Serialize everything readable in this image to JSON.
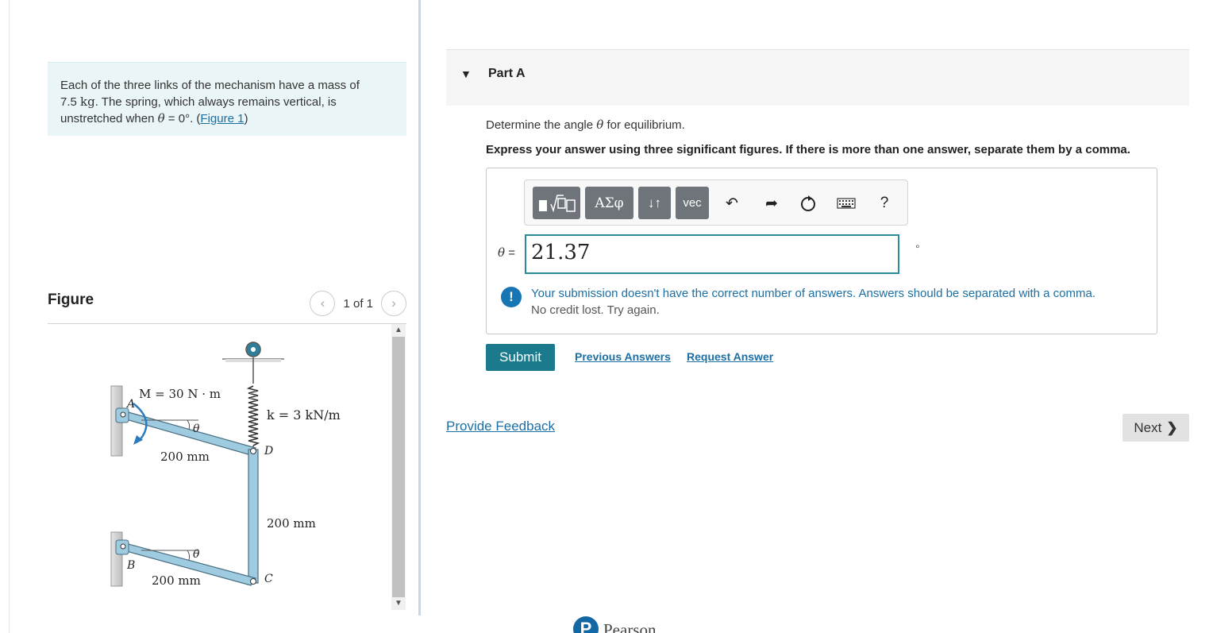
{
  "problem": {
    "text_1": "Each of the three links of the mechanism have a mass of",
    "mass_value": "7.5",
    "mass_unit": "kg",
    "text_2": ". The spring, which always remains vertical, is",
    "text_3": "unstretched when",
    "theta_symbol": "θ",
    "text_4": "= 0°. (",
    "figure_link": "Figure 1",
    "text_5": ")"
  },
  "figure": {
    "title": "Figure",
    "counter": "1 of 1",
    "prev_icon": "chevron-left-icon",
    "next_icon": "chevron-right-icon",
    "labels": {
      "moment": "M = 30 N · m",
      "a": "A",
      "b": "B",
      "c": "C",
      "d": "D",
      "spring": "k = 3 kN/m",
      "theta_top": "θ",
      "theta_bottom": "θ",
      "len_top": "200 mm",
      "len_vertical": "200 mm",
      "len_bottom": "200 mm"
    }
  },
  "part_a": {
    "title": "Part A",
    "question_prefix": "Determine the angle",
    "theta_symbol": "θ",
    "question_suffix": "for equilibrium.",
    "instruction": "Express your answer using three significant figures. If there is more than one answer, separate them by a comma.",
    "toolbar": {
      "templates_icon": "templates-icon",
      "greek_label": "ΑΣφ",
      "arrows_label": "↓↑",
      "vec_label": "vec",
      "undo_icon": "undo-icon",
      "redo_icon": "redo-icon",
      "reset_icon": "reset-icon",
      "keyboard_icon": "keyboard-icon",
      "help_label": "?"
    },
    "answer_label_theta": "θ",
    "answer_label_eq": " =",
    "answer_value": "21.37",
    "unit": "°",
    "feedback_icon": "!",
    "feedback_text": "Your submission doesn't have the correct number of answers. Answers should be separated with a comma.",
    "feedback_sub": "No credit lost. Try again.",
    "submit_label": "Submit",
    "previous_answers": "Previous Answers",
    "request_answer": "Request Answer"
  },
  "footer": {
    "provide_feedback": "Provide Feedback",
    "next_label": "Next",
    "brand": "Pearson",
    "brand_initial": "P"
  },
  "colors": {
    "accent_teal": "#1b7a8c",
    "link_blue": "#1c6fa3",
    "problem_bg": "#e9f5f7",
    "link_bar": "#9fcbe0"
  }
}
